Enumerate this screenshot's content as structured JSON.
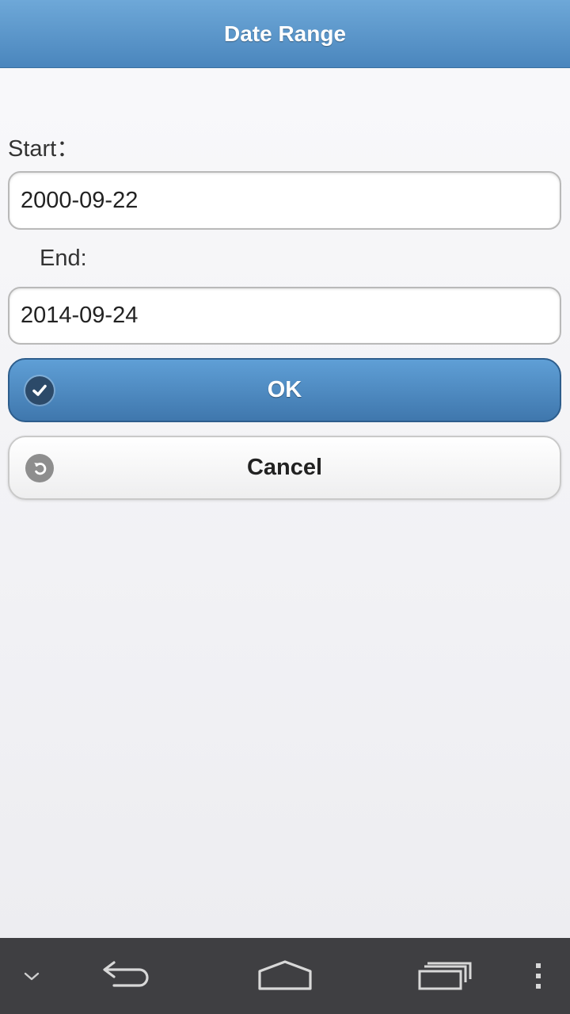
{
  "header": {
    "title": "Date Range"
  },
  "form": {
    "start_label": "Start：",
    "start_value": "2000-09-22",
    "end_label": "End:",
    "end_value": "2014-09-24"
  },
  "buttons": {
    "ok_label": "OK",
    "cancel_label": "Cancel"
  },
  "icons": {
    "ok": "check-icon",
    "cancel": "undo-icon",
    "nav": [
      "chevron-down-icon",
      "back-icon",
      "home-icon",
      "recent-apps-icon",
      "menu-icon"
    ]
  },
  "colors": {
    "header_top": "#6ea8d8",
    "header_bottom": "#4a86bd",
    "ok_button": "#4a86bd",
    "navbar": "#3f3f42"
  }
}
